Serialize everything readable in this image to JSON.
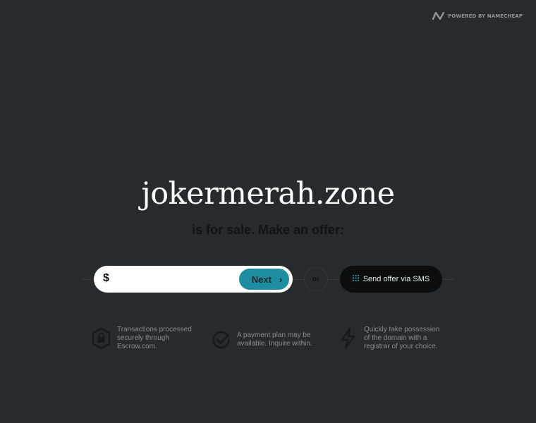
{
  "brand": {
    "logo_icon": "namecheap-logo-icon",
    "text": "POWERED BY NAMECHEAP"
  },
  "listing": {
    "domain": "jokermerah.zone",
    "subtitle": "is for sale.  Make an offer:"
  },
  "offer_form": {
    "currency_symbol": "$",
    "input_value": "",
    "input_placeholder": "",
    "next_label": "Next",
    "next_icon": "chevron-right-icon",
    "or_label": "or",
    "sms_label": "Send offer via SMS",
    "sms_icon": "keypad-icon"
  },
  "features": [
    {
      "icon": "shield-lock-icon",
      "text": "Transactions processed securely through Escrow.com."
    },
    {
      "icon": "check-circle-icon",
      "text": "A payment plan may be available. Inquire within."
    },
    {
      "icon": "lightning-icon",
      "text": "Quickly take possession of the domain with a registrar of your choice."
    }
  ],
  "colors": {
    "background": "#262b2e",
    "accent": "#1d8da1",
    "sms_button": "#0b0d0e"
  }
}
